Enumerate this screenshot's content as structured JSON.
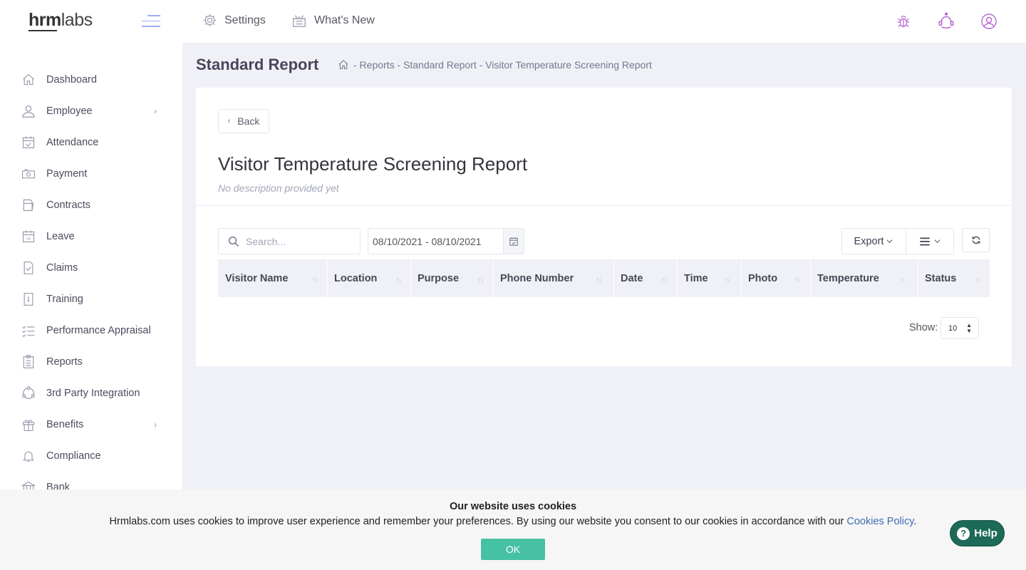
{
  "logo": {
    "bold": "hrm",
    "light": "labs"
  },
  "topnav": {
    "settings": "Settings",
    "whats_new": "What's New"
  },
  "sidebar": {
    "items": [
      {
        "label": "Dashboard",
        "icon": "home-icon",
        "chevron": ""
      },
      {
        "label": "Employee",
        "icon": "user-icon",
        "chevron": "›"
      },
      {
        "label": "Attendance",
        "icon": "calendar-check-icon",
        "chevron": ""
      },
      {
        "label": "Payment",
        "icon": "money-icon",
        "chevron": ""
      },
      {
        "label": "Contracts",
        "icon": "folder-icon",
        "chevron": ""
      },
      {
        "label": "Leave",
        "icon": "calendar-icon",
        "chevron": ""
      },
      {
        "label": "Claims",
        "icon": "document-check-icon",
        "chevron": ""
      },
      {
        "label": "Training",
        "icon": "training-icon",
        "chevron": ""
      },
      {
        "label": "Performance Appraisal",
        "icon": "checklist-icon",
        "chevron": ""
      },
      {
        "label": "Reports",
        "icon": "clipboard-icon",
        "chevron": ""
      },
      {
        "label": "3rd Party Integration",
        "icon": "integration-icon",
        "chevron": ""
      },
      {
        "label": "Benefits",
        "icon": "gift-icon",
        "chevron": "›"
      },
      {
        "label": "Compliance",
        "icon": "bell-icon",
        "chevron": ""
      },
      {
        "label": "Bank",
        "icon": "bank-icon",
        "chevron": ""
      }
    ]
  },
  "page": {
    "title": "Standard Report",
    "breadcrumb": "- Reports - Standard Report - Visitor Temperature Screening Report"
  },
  "report": {
    "back_label": "Back",
    "title": "Visitor Temperature Screening Report",
    "description": "No description provided yet"
  },
  "filters": {
    "search_placeholder": "Search...",
    "date_range": "08/10/2021 - 08/10/2021",
    "export_label": "Export"
  },
  "table": {
    "columns": [
      "Visitor Name",
      "Location",
      "Purpose",
      "Phone Number",
      "Date",
      "Time",
      "Photo",
      "Temperature",
      "Status"
    ],
    "rows": []
  },
  "pagination": {
    "show_label": "Show:",
    "page_size": "10"
  },
  "cookie": {
    "title": "Our website uses cookies",
    "text": "Hrmlabs.com uses cookies to improve user experience and remember your preferences. By using our website you consent to our cookies in accordance with our ",
    "link": "Cookies Policy",
    "period": ".",
    "ok": "OK"
  },
  "help": {
    "label": "Help"
  },
  "colors": {
    "accent": "#5d78ff",
    "ok_button": "#47c1a4",
    "help_button": "#1c6a57",
    "profile_icons": "#b866d4"
  }
}
